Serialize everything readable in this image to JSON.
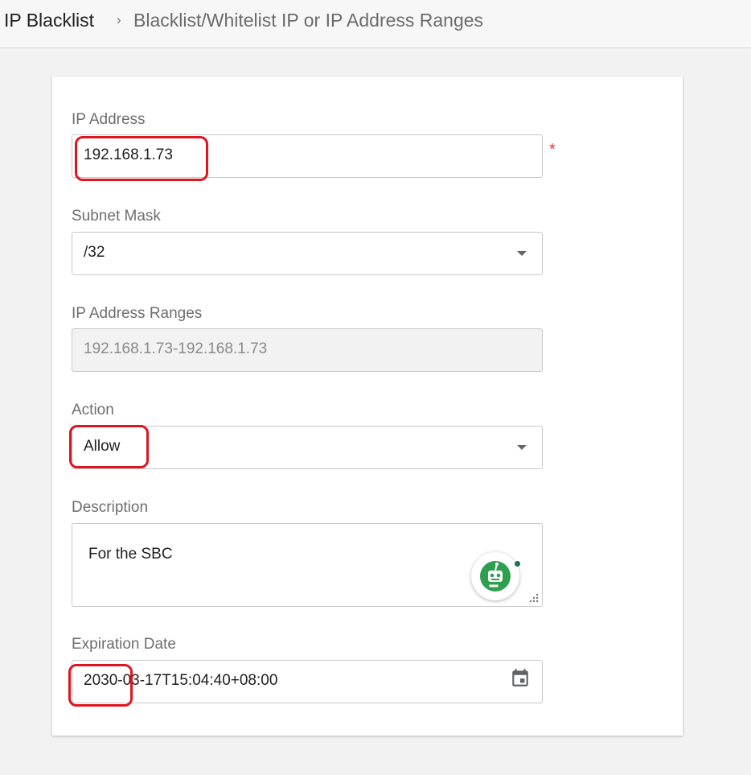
{
  "breadcrumb": {
    "root": "IP Blacklist",
    "separator": "›",
    "current": "Blacklist/Whitelist IP or IP Address Ranges"
  },
  "form": {
    "ip_address": {
      "label": "IP Address",
      "value": "192.168.1.73",
      "required_marker": "*"
    },
    "subnet_mask": {
      "label": "Subnet Mask",
      "value": "/32"
    },
    "ip_ranges": {
      "label": "IP Address Ranges",
      "value": "192.168.1.73-192.168.1.73"
    },
    "action": {
      "label": "Action",
      "value": "Allow"
    },
    "description": {
      "label": "Description",
      "value": "For the SBC"
    },
    "expiration": {
      "label": "Expiration Date",
      "value": "2030-03-17T15:04:40+08:00"
    }
  },
  "icons": {
    "dropdown": "chevron-down-icon",
    "calendar": "calendar-icon",
    "assistant": "bot-icon",
    "resize": "resize-grip-icon"
  },
  "colors": {
    "required": "#e53935",
    "annotation": "#e0141e",
    "assistant_green": "#2e9e4f"
  }
}
